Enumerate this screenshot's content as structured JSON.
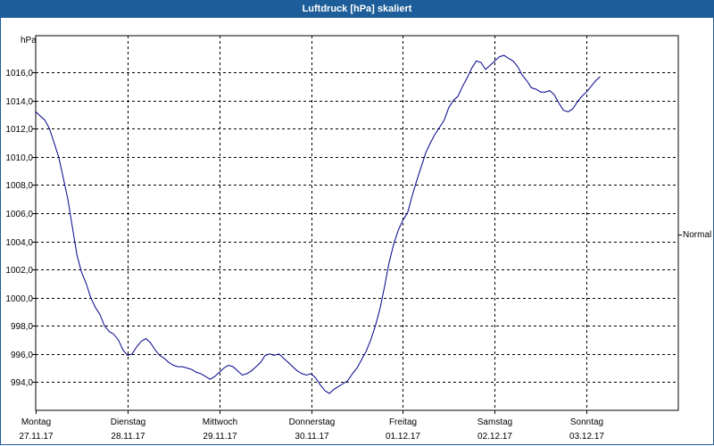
{
  "window": {
    "title": "Luftdruck [hPa] skaliert"
  },
  "colors": {
    "titlebar": "#1d5d99",
    "line": "#00008b",
    "grid": "#000000"
  },
  "chart_data": {
    "type": "line",
    "title": "Luftdruck [hPa] skaliert",
    "ylabel": "hPa",
    "xlabel": "",
    "ylim": [
      992.0,
      1018.6
    ],
    "xlim": [
      0,
      7
    ],
    "grid": true,
    "y_ticks": [
      994.0,
      996.0,
      998.0,
      1000.0,
      1002.0,
      1004.0,
      1006.0,
      1008.0,
      1010.0,
      1012.0,
      1014.0,
      1016.0
    ],
    "y_tick_labels": [
      "994,0",
      "996,0",
      "998,0",
      "1000,0",
      "1002,0",
      "1004,0",
      "1006,0",
      "1008,0",
      "1010,0",
      "1012,0",
      "1014,0",
      "1016,0"
    ],
    "x_ticks": [
      {
        "pos": 0,
        "day": "Montag",
        "date": "27.11.17"
      },
      {
        "pos": 1,
        "day": "Dienstag",
        "date": "28.11.17"
      },
      {
        "pos": 2,
        "day": "Mittwoch",
        "date": "29.11.17"
      },
      {
        "pos": 3,
        "day": "Donnerstag",
        "date": "30.11.17"
      },
      {
        "pos": 4,
        "day": "Freitag",
        "date": "01.12.17"
      },
      {
        "pos": 5,
        "day": "Samstag",
        "date": "02.12.17"
      },
      {
        "pos": 6,
        "day": "Sonntag",
        "date": "03.12.17"
      }
    ],
    "right_label": {
      "value": 1004.5,
      "text": "Normal"
    },
    "series": [
      {
        "values": [
          [
            0.0,
            1013.2
          ],
          [
            0.05,
            1012.9
          ],
          [
            0.1,
            1012.6
          ],
          [
            0.15,
            1012.0
          ],
          [
            0.2,
            1011.0
          ],
          [
            0.25,
            1010.0
          ],
          [
            0.3,
            1008.5
          ],
          [
            0.35,
            1007.0
          ],
          [
            0.4,
            1005.0
          ],
          [
            0.45,
            1003.0
          ],
          [
            0.5,
            1001.8
          ],
          [
            0.55,
            1001.0
          ],
          [
            0.6,
            1000.0
          ],
          [
            0.65,
            999.3
          ],
          [
            0.7,
            998.8
          ],
          [
            0.75,
            998.0
          ],
          [
            0.8,
            997.6
          ],
          [
            0.85,
            997.4
          ],
          [
            0.9,
            997.0
          ],
          [
            0.95,
            996.3
          ],
          [
            1.0,
            995.9
          ],
          [
            1.05,
            996.0
          ],
          [
            1.1,
            996.5
          ],
          [
            1.15,
            996.9
          ],
          [
            1.2,
            997.1
          ],
          [
            1.25,
            996.8
          ],
          [
            1.3,
            996.3
          ],
          [
            1.35,
            995.9
          ],
          [
            1.4,
            995.7
          ],
          [
            1.45,
            995.4
          ],
          [
            1.5,
            995.2
          ],
          [
            1.55,
            995.1
          ],
          [
            1.6,
            995.1
          ],
          [
            1.65,
            995.0
          ],
          [
            1.7,
            994.9
          ],
          [
            1.75,
            994.7
          ],
          [
            1.8,
            994.6
          ],
          [
            1.85,
            994.4
          ],
          [
            1.9,
            994.2
          ],
          [
            1.95,
            994.4
          ],
          [
            2.0,
            994.7
          ],
          [
            2.05,
            995.0
          ],
          [
            2.1,
            995.2
          ],
          [
            2.15,
            995.1
          ],
          [
            2.2,
            994.8
          ],
          [
            2.25,
            994.5
          ],
          [
            2.3,
            994.6
          ],
          [
            2.35,
            994.8
          ],
          [
            2.4,
            995.1
          ],
          [
            2.45,
            995.4
          ],
          [
            2.5,
            995.9
          ],
          [
            2.55,
            996.0
          ],
          [
            2.6,
            995.9
          ],
          [
            2.65,
            996.0
          ],
          [
            2.7,
            995.7
          ],
          [
            2.75,
            995.4
          ],
          [
            2.8,
            995.1
          ],
          [
            2.85,
            994.8
          ],
          [
            2.9,
            994.6
          ],
          [
            2.95,
            994.5
          ],
          [
            3.0,
            994.6
          ],
          [
            3.05,
            994.3
          ],
          [
            3.1,
            993.8
          ],
          [
            3.15,
            993.4
          ],
          [
            3.2,
            993.2
          ],
          [
            3.25,
            993.5
          ],
          [
            3.3,
            993.7
          ],
          [
            3.35,
            993.9
          ],
          [
            3.4,
            994.1
          ],
          [
            3.45,
            994.6
          ],
          [
            3.5,
            995.0
          ],
          [
            3.55,
            995.6
          ],
          [
            3.6,
            996.2
          ],
          [
            3.65,
            997.0
          ],
          [
            3.7,
            998.0
          ],
          [
            3.75,
            999.2
          ],
          [
            3.8,
            1000.8
          ],
          [
            3.85,
            1002.5
          ],
          [
            3.9,
            1003.8
          ],
          [
            3.95,
            1004.8
          ],
          [
            4.0,
            1005.5
          ],
          [
            4.05,
            1006.0
          ],
          [
            4.1,
            1007.2
          ],
          [
            4.15,
            1008.3
          ],
          [
            4.2,
            1009.3
          ],
          [
            4.25,
            1010.3
          ],
          [
            4.3,
            1011.0
          ],
          [
            4.35,
            1011.6
          ],
          [
            4.4,
            1012.1
          ],
          [
            4.45,
            1012.6
          ],
          [
            4.5,
            1013.5
          ],
          [
            4.55,
            1014.0
          ],
          [
            4.6,
            1014.3
          ],
          [
            4.65,
            1015.0
          ],
          [
            4.7,
            1015.6
          ],
          [
            4.75,
            1016.3
          ],
          [
            4.8,
            1016.8
          ],
          [
            4.85,
            1016.7
          ],
          [
            4.9,
            1016.2
          ],
          [
            4.95,
            1016.5
          ],
          [
            5.0,
            1016.8
          ],
          [
            5.05,
            1017.1
          ],
          [
            5.1,
            1017.2
          ],
          [
            5.15,
            1017.0
          ],
          [
            5.2,
            1016.8
          ],
          [
            5.25,
            1016.4
          ],
          [
            5.3,
            1015.8
          ],
          [
            5.35,
            1015.4
          ],
          [
            5.4,
            1014.9
          ],
          [
            5.45,
            1014.8
          ],
          [
            5.5,
            1014.6
          ],
          [
            5.55,
            1014.6
          ],
          [
            5.6,
            1014.7
          ],
          [
            5.65,
            1014.4
          ],
          [
            5.7,
            1013.8
          ],
          [
            5.75,
            1013.3
          ],
          [
            5.8,
            1013.2
          ],
          [
            5.85,
            1013.4
          ],
          [
            5.9,
            1013.9
          ],
          [
            5.95,
            1014.3
          ],
          [
            6.0,
            1014.6
          ],
          [
            6.05,
            1015.0
          ],
          [
            6.1,
            1015.4
          ],
          [
            6.15,
            1015.7
          ]
        ]
      }
    ]
  }
}
